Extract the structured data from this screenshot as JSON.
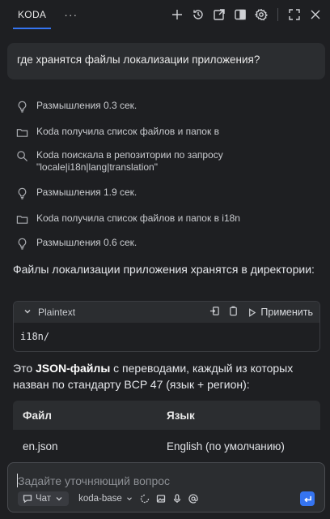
{
  "header": {
    "tab_label": "KODA",
    "more_label": "···",
    "actions": [
      "plus-icon",
      "history-icon",
      "open-in-window-icon",
      "split-view-icon",
      "settings-icon",
      "expand-icon",
      "close-icon"
    ]
  },
  "chat": {
    "question": "где хранятся файлы локализации приложения?",
    "steps": [
      {
        "icon": "lightbulb-icon",
        "text": "Размышления 0.3 сек."
      },
      {
        "icon": "folder-icon",
        "text": "Koda получила список файлов и папок в"
      },
      {
        "icon": "search-icon",
        "text": "Koda поискала в репозитории по запросу",
        "text2": "\"locale|i18n|lang|translation\""
      },
      {
        "icon": "lightbulb-icon",
        "text": "Размышления 1.9 сек."
      },
      {
        "icon": "folder-icon",
        "text": "Koda получила список файлов и папок в i18n"
      },
      {
        "icon": "lightbulb-icon",
        "text": "Размышления 0.6 сек."
      }
    ],
    "answer_intro": "Файлы локализации приложения хранятся в директории:",
    "code": {
      "language": "Plaintext",
      "apply_label": "Применить",
      "content": "i18n/"
    },
    "answer_2_prefix": "Это ",
    "answer_2_bold": "JSON-файлы",
    "answer_2_suffix": " с переводами, каждый из которых назван по стандарту BCP 47 (язык + регион):",
    "table": {
      "headers": [
        "Файл",
        "Язык"
      ],
      "rows": [
        [
          "en.json",
          "English (по умолчанию)"
        ]
      ]
    }
  },
  "input": {
    "placeholder": "Задайте уточняющий вопрос",
    "mode_label": "Чат",
    "model_label": "koda-base"
  },
  "colors": {
    "background": "#1e1f22",
    "panel": "#2b2d30",
    "accent": "#3574f0"
  }
}
